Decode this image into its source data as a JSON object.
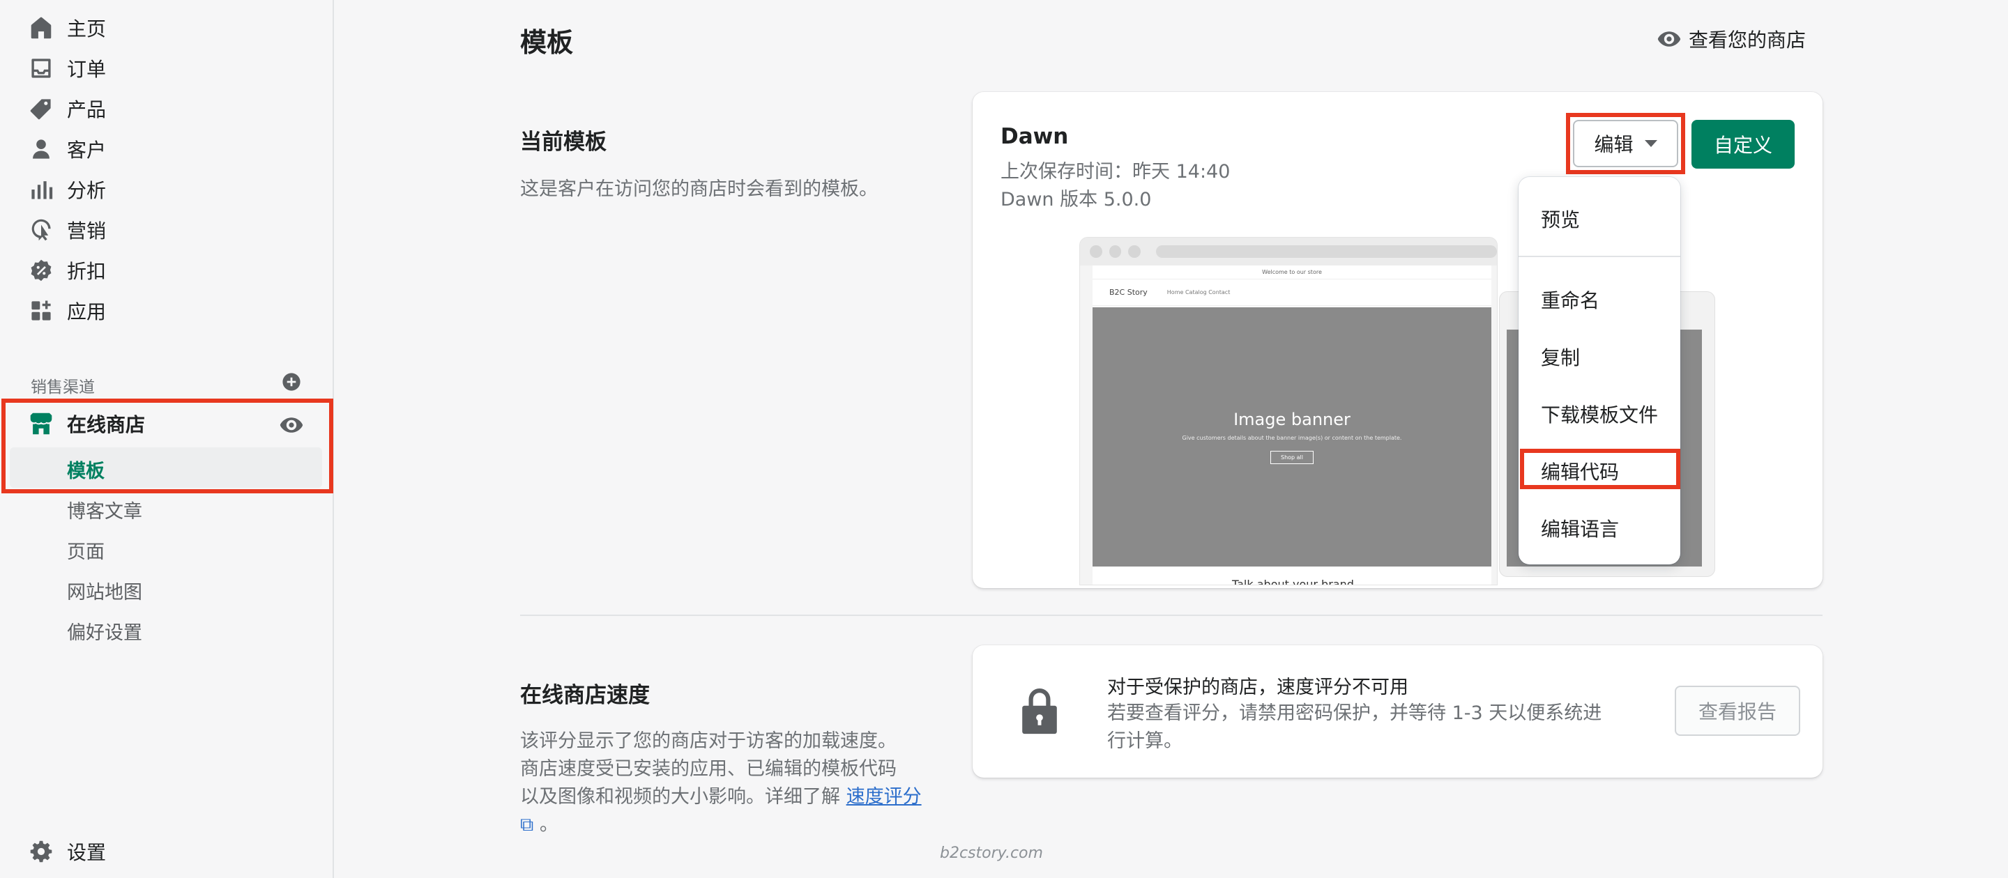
{
  "sidebar": {
    "items": [
      {
        "label": "主页",
        "icon": "home-icon"
      },
      {
        "label": "订单",
        "icon": "orders-icon"
      },
      {
        "label": "产品",
        "icon": "tag-icon"
      },
      {
        "label": "客户",
        "icon": "customer-icon"
      },
      {
        "label": "分析",
        "icon": "analytics-icon"
      },
      {
        "label": "营销",
        "icon": "marketing-icon"
      },
      {
        "label": "折扣",
        "icon": "discount-icon"
      },
      {
        "label": "应用",
        "icon": "apps-icon"
      }
    ],
    "channels_label": "销售渠道",
    "online_store": "在线商店",
    "sub_items": [
      "模板",
      "博客文章",
      "页面",
      "网站地图",
      "偏好设置"
    ],
    "settings": "设置"
  },
  "header": {
    "title": "模板",
    "view_store": "查看您的商店"
  },
  "current_theme": {
    "section_title": "当前模板",
    "section_desc": "这是客户在访问您的商店时会看到的模板。",
    "theme_name": "Dawn",
    "last_saved": "上次保存时间：昨天 14:40",
    "version": "Dawn 版本 5.0.0",
    "edit_label": "编辑",
    "customize_label": "自定义",
    "preview": {
      "announcement": "Welcome to our store",
      "brand": "B2C Story",
      "nav_links": "Home   Catalog   Contact",
      "banner_title": "Image banner",
      "banner_sub": "Give customers details about the banner image(s) or content on the template.",
      "banner_button": "Shop all",
      "caption": "Talk about your brand"
    }
  },
  "dropdown": {
    "items": [
      "预览",
      "重命名",
      "复制",
      "下载模板文件",
      "编辑代码",
      "编辑语言"
    ]
  },
  "speed": {
    "section_title": "在线商店速度",
    "desc_line1": "该评分显示了您的商店对于访客的加载速度。",
    "desc_line2": "商店速度受已安装的应用、已编辑的模板代码",
    "desc_line3": "以及图像和视频的大小影响。详细了解 ",
    "link_text": "速度评分",
    "desc_end": " 。",
    "card_title": "对于受保护的商店，速度评分不可用",
    "card_desc": "若要查看评分，请禁用密码保护，并等待 1-3 天以便系统进行计算。",
    "report_button": "查看报告"
  },
  "watermark": "b2cstory.com"
}
